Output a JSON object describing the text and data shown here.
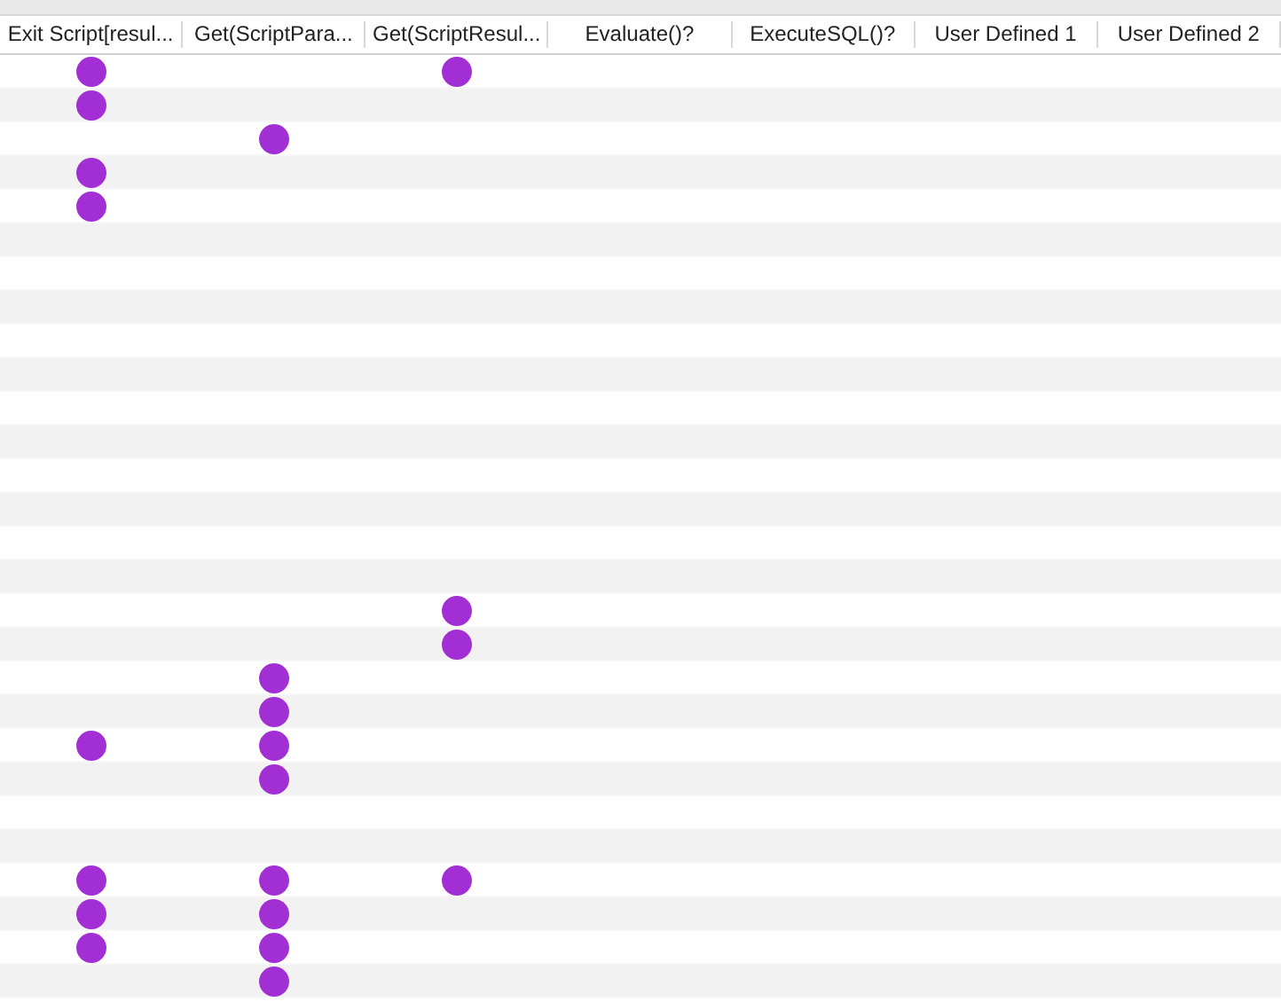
{
  "table": {
    "columns": [
      "Exit Script[resul...",
      "Get(ScriptPara...",
      "Get(ScriptResul...",
      "Evaluate()?",
      "ExecuteSQL()?",
      "User Defined 1",
      "User Defined 2"
    ],
    "rows": [
      {
        "flags": [
          true,
          false,
          true
        ]
      },
      {
        "flags": [
          true,
          false,
          false
        ]
      },
      {
        "flags": [
          false,
          true,
          false
        ]
      },
      {
        "flags": [
          true,
          false,
          false
        ]
      },
      {
        "flags": [
          true,
          false,
          false
        ]
      },
      {
        "flags": [
          false,
          false,
          false
        ]
      },
      {
        "flags": [
          false,
          false,
          false
        ]
      },
      {
        "flags": [
          false,
          false,
          false
        ]
      },
      {
        "flags": [
          false,
          false,
          false
        ]
      },
      {
        "flags": [
          false,
          false,
          false
        ]
      },
      {
        "flags": [
          false,
          false,
          false
        ]
      },
      {
        "flags": [
          false,
          false,
          false
        ]
      },
      {
        "flags": [
          false,
          false,
          false
        ]
      },
      {
        "flags": [
          false,
          false,
          false
        ]
      },
      {
        "flags": [
          false,
          false,
          false
        ]
      },
      {
        "flags": [
          false,
          false,
          false
        ]
      },
      {
        "flags": [
          false,
          false,
          true
        ]
      },
      {
        "flags": [
          false,
          false,
          true
        ]
      },
      {
        "flags": [
          false,
          true,
          false
        ]
      },
      {
        "flags": [
          false,
          true,
          false
        ]
      },
      {
        "flags": [
          true,
          true,
          false
        ]
      },
      {
        "flags": [
          false,
          true,
          false
        ]
      },
      {
        "flags": [
          false,
          false,
          false
        ]
      },
      {
        "flags": [
          false,
          false,
          false
        ]
      },
      {
        "flags": [
          true,
          true,
          true
        ]
      },
      {
        "flags": [
          true,
          true,
          false
        ]
      },
      {
        "flags": [
          true,
          true,
          false
        ]
      },
      {
        "flags": [
          false,
          true,
          false
        ]
      }
    ]
  }
}
